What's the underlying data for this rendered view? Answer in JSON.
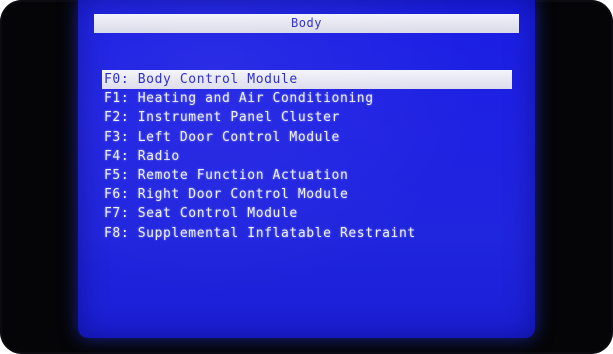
{
  "screen": {
    "title": "Body"
  },
  "menu": {
    "items": [
      {
        "key": "F0",
        "label": "Body Control Module",
        "selected": true
      },
      {
        "key": "F1",
        "label": "Heating and Air Conditioning",
        "selected": false
      },
      {
        "key": "F2",
        "label": "Instrument Panel Cluster",
        "selected": false
      },
      {
        "key": "F3",
        "label": "Left Door Control Module",
        "selected": false
      },
      {
        "key": "F4",
        "label": "Radio",
        "selected": false
      },
      {
        "key": "F5",
        "label": "Remote Function Actuation",
        "selected": false
      },
      {
        "key": "F6",
        "label": "Right Door Control Module",
        "selected": false
      },
      {
        "key": "F7",
        "label": "Seat Control Module",
        "selected": false
      },
      {
        "key": "F8",
        "label": "Supplemental Inflatable Restraint",
        "selected": false
      }
    ],
    "separator": ": "
  },
  "colors": {
    "screen_background": "#1f22e2",
    "text": "#eef0ff",
    "highlight_background": "#e6e6f4",
    "highlight_text": "#2426c8",
    "bezel": "#050507"
  }
}
